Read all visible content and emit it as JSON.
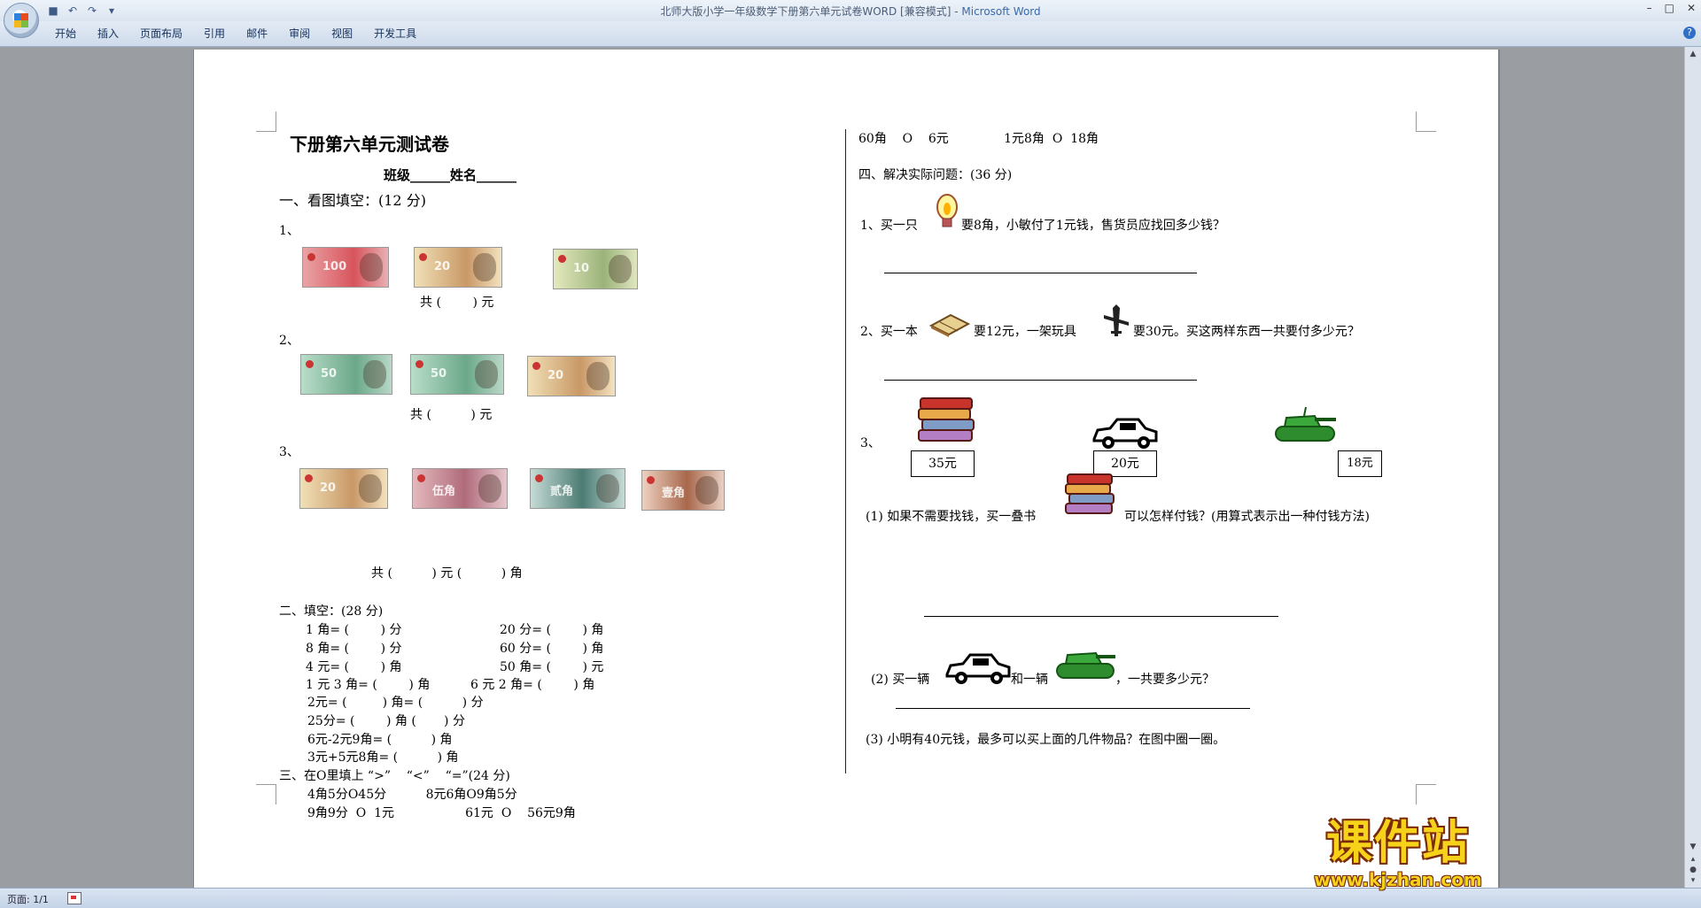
{
  "window": {
    "title_doc": "北师大版小学一年级数学下册第六单元试卷WORD [兼容模式] - ",
    "title_app": "Microsoft Word"
  },
  "ribbon": {
    "tabs": [
      "开始",
      "插入",
      "页面布局",
      "引用",
      "邮件",
      "审阅",
      "视图",
      "开发工具"
    ]
  },
  "status": {
    "page": "页面: 1/1"
  },
  "left": {
    "title": "下册第六单元测试卷",
    "class_name": "班级______姓名______",
    "s1_heading": "一、看图填空：(12 分)",
    "q1_label": "1、",
    "q1_sum": "共 (        ) 元",
    "q2_label": "2、",
    "q2_sum": "共 (          ) 元",
    "q3_label": "3、",
    "q3_sum": "共 (          ) 元 (          ) 角",
    "s2_heading": "二、填空：(28 分)",
    "fills": [
      [
        "1 角= (        ) 分",
        "20 分= (        ) 角"
      ],
      [
        "8 角= (        ) 分",
        "60 分= (        ) 角"
      ],
      [
        "4 元= (        ) 角",
        "50 角= (        ) 元"
      ],
      [
        "1 元 3 角= (        ) 角",
        "6 元 2 角= (        ) 角"
      ]
    ],
    "fills_more": [
      "2元= (         ) 角= (          ) 分",
      "25分= (        ) 角 (       ) 分",
      "6元-2元9角= (          ) 角",
      "3元+5元8角= (          ) 角"
    ],
    "s3_heading": "三、在O里填上 “>”    “<”    “=”(24 分)",
    "cmp1": "4角5分O45分          8元6角O9角5分",
    "cmp2": "9角9分  O  1元                  61元  O    56元9角"
  },
  "right": {
    "cmp3": "60角    O    6元              1元8角  O  18角",
    "s4_heading": "四、解决实际问题：(36 分)",
    "p1_a": "1、买一只",
    "p1_b": "要8角，小敏付了1元钱，售货员应找回多少钱？",
    "p2_a": "2、买一本",
    "p2_b": "要12元，一架玩具",
    "p2_c": "要30元。买这两样东西一共要付多少元？",
    "p3_label": "3、",
    "price_books": "35元",
    "price_car": "20元",
    "price_tank": "18元",
    "p3_1_a": "(1) 如果不需要找钱，买一叠书",
    "p3_1_b": "可以怎样付钱？(用算式表示出一种付钱方法)",
    "p3_2_a": "(2) 买一辆",
    "p3_2_b": "和一辆",
    "p3_2_c": "，一共要多少元？",
    "p3_3": "(3) 小明有40元钱，最多可以买上面的几件物品？在图中圈一圈。"
  },
  "notes": {
    "q1": [
      "100",
      "20",
      "10"
    ],
    "q2": [
      "50",
      "50",
      "20"
    ],
    "q3": [
      "20",
      "伍角",
      "贰角",
      "壹角"
    ]
  },
  "watermark": {
    "main": "课件站",
    "url": "www.kjzhan.com"
  }
}
